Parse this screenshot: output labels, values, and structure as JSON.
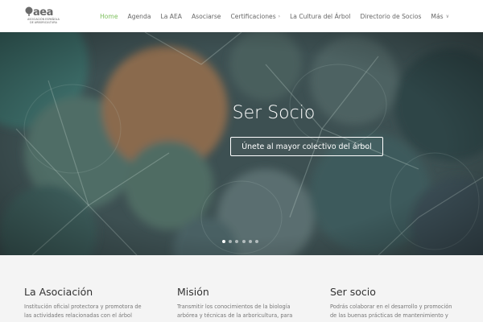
{
  "logo": {
    "mark": "aea",
    "line1": "ASOCIACIÓN ESPAÑOLA",
    "line2": "DE ARBORICULTURA"
  },
  "nav": {
    "items": [
      {
        "label": "Home",
        "active": true
      },
      {
        "label": "Agenda"
      },
      {
        "label": "La AEA"
      },
      {
        "label": "Asociarse"
      },
      {
        "label": "Certificaciones",
        "caret": "›"
      },
      {
        "label": "La Cultura del Árbol"
      },
      {
        "label": "Directorio de Socios"
      },
      {
        "label": "Más",
        "caret": "∨"
      }
    ],
    "active_color": "#7bbf5a"
  },
  "hero": {
    "title": "Ser Socio",
    "button": "Únete al mayor colectivo del árbol",
    "slides": 6,
    "active_slide": 1
  },
  "sections": [
    {
      "title": "La Asociación",
      "text_line1": "Institución oficial protectora y promotora de",
      "text_line2": "las actividades relacionadas con el árbol"
    },
    {
      "title": "Misión",
      "text_line1": "Transmitir los conocimientos de la biología",
      "text_line2": "arbórea y  técnicas de la arboricultura, para"
    },
    {
      "title": "Ser socio",
      "text_line1": "Podrás colaborar en el desarrollo y promoción",
      "text_line2": "de las buenas prácticas de mantenimiento y"
    }
  ]
}
